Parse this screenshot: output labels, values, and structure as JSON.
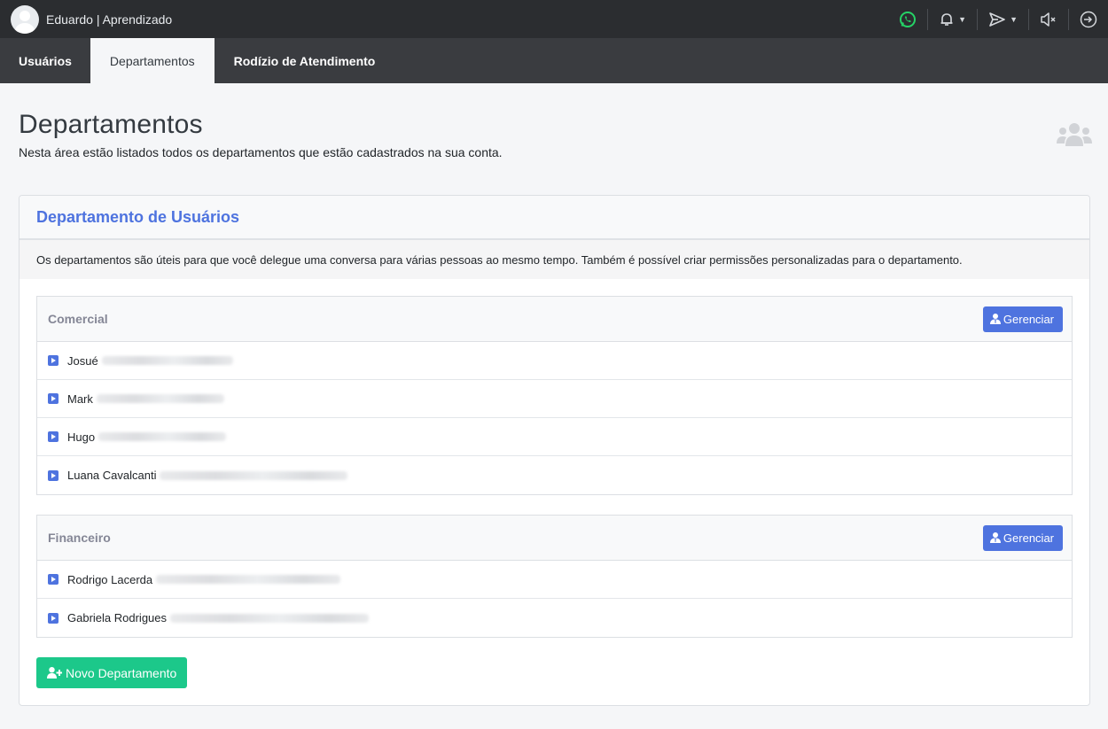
{
  "topbar": {
    "user_name": "Eduardo | Aprendizado",
    "icons": [
      "whatsapp-icon",
      "bell-icon",
      "send-icon",
      "mute-icon",
      "logout-icon"
    ],
    "whatsapp_color": "#25d366"
  },
  "tabs": [
    {
      "label": "Usuários",
      "active": false
    },
    {
      "label": "Departamentos",
      "active": true
    },
    {
      "label": "Rodízio de Atendimento",
      "active": false
    }
  ],
  "page": {
    "title": "Departamentos",
    "subtitle": "Nesta área estão listados todos os departamentos que estão cadastrados na sua conta."
  },
  "card": {
    "title": "Departamento de Usuários",
    "description": "Os departamentos são úteis para que você delegue uma conversa para várias pessoas ao mesmo tempo. Também é possível criar permissões personalizadas para o departamento.",
    "accent_color": "#4e73df"
  },
  "departments": [
    {
      "name": "Comercial",
      "manage_label": "Gerenciar",
      "members": [
        "Josué",
        "Mark",
        "Hugo",
        "Luana Cavalcanti"
      ]
    },
    {
      "name": "Financeiro",
      "manage_label": "Gerenciar",
      "members": [
        "Rodrigo Lacerda",
        "Gabriela Rodrigues"
      ]
    }
  ],
  "new_department_label": "Novo Departamento",
  "new_department_color": "#1cc88a"
}
